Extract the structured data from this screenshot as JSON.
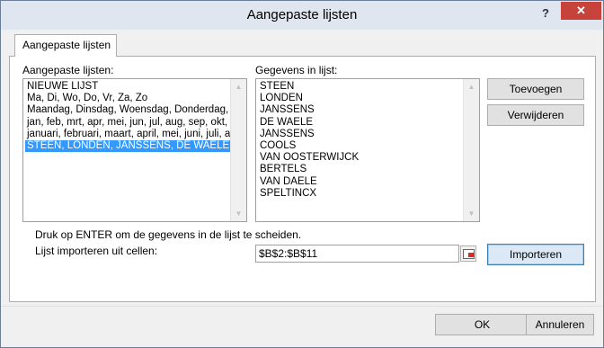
{
  "window": {
    "title": "Aangepaste lijsten",
    "help_glyph": "?",
    "close_glyph": "✕"
  },
  "tab": {
    "label": "Aangepaste lijsten"
  },
  "custom_lists": {
    "label": "Aangepaste lijsten:",
    "items": [
      "NIEUWE LIJST",
      "Ma, Di, Wo, Do, Vr, Za, Zo",
      "Maandag, Dinsdag, Woensdag, Donderdag, Vrijdag, Zaterdag, Zondag",
      "jan, feb, mrt, apr, mei, jun, jul, aug, sep, okt, nov, dec",
      "januari, februari, maart, april, mei, juni, juli, augustus, september, oktober, november, december",
      "STEEN, LONDEN, JANSSENS, DE WAELE, JANSSENS, COOLS, VAN OOSTERWIJCK, BERTELS, VAN DAELE, SPELTINCX"
    ],
    "selected_index": 5
  },
  "list_entries": {
    "label": "Gegevens in lijst:",
    "items": [
      "STEEN",
      "LONDEN",
      "JANSSENS",
      "DE WAELE",
      "JANSSENS",
      "COOLS",
      "VAN OOSTERWIJCK",
      "BERTELS",
      "VAN DAELE",
      "SPELTINCX"
    ]
  },
  "buttons": {
    "add": "Toevoegen",
    "delete": "Verwijderen",
    "import": "Importeren",
    "ok": "OK",
    "cancel": "Annuleren"
  },
  "hint_text": "Druk op ENTER om de gegevens in de lijst te scheiden.",
  "import_range": {
    "label": "Lijst importeren uit cellen:",
    "value": "$B$2:$B$11"
  }
}
